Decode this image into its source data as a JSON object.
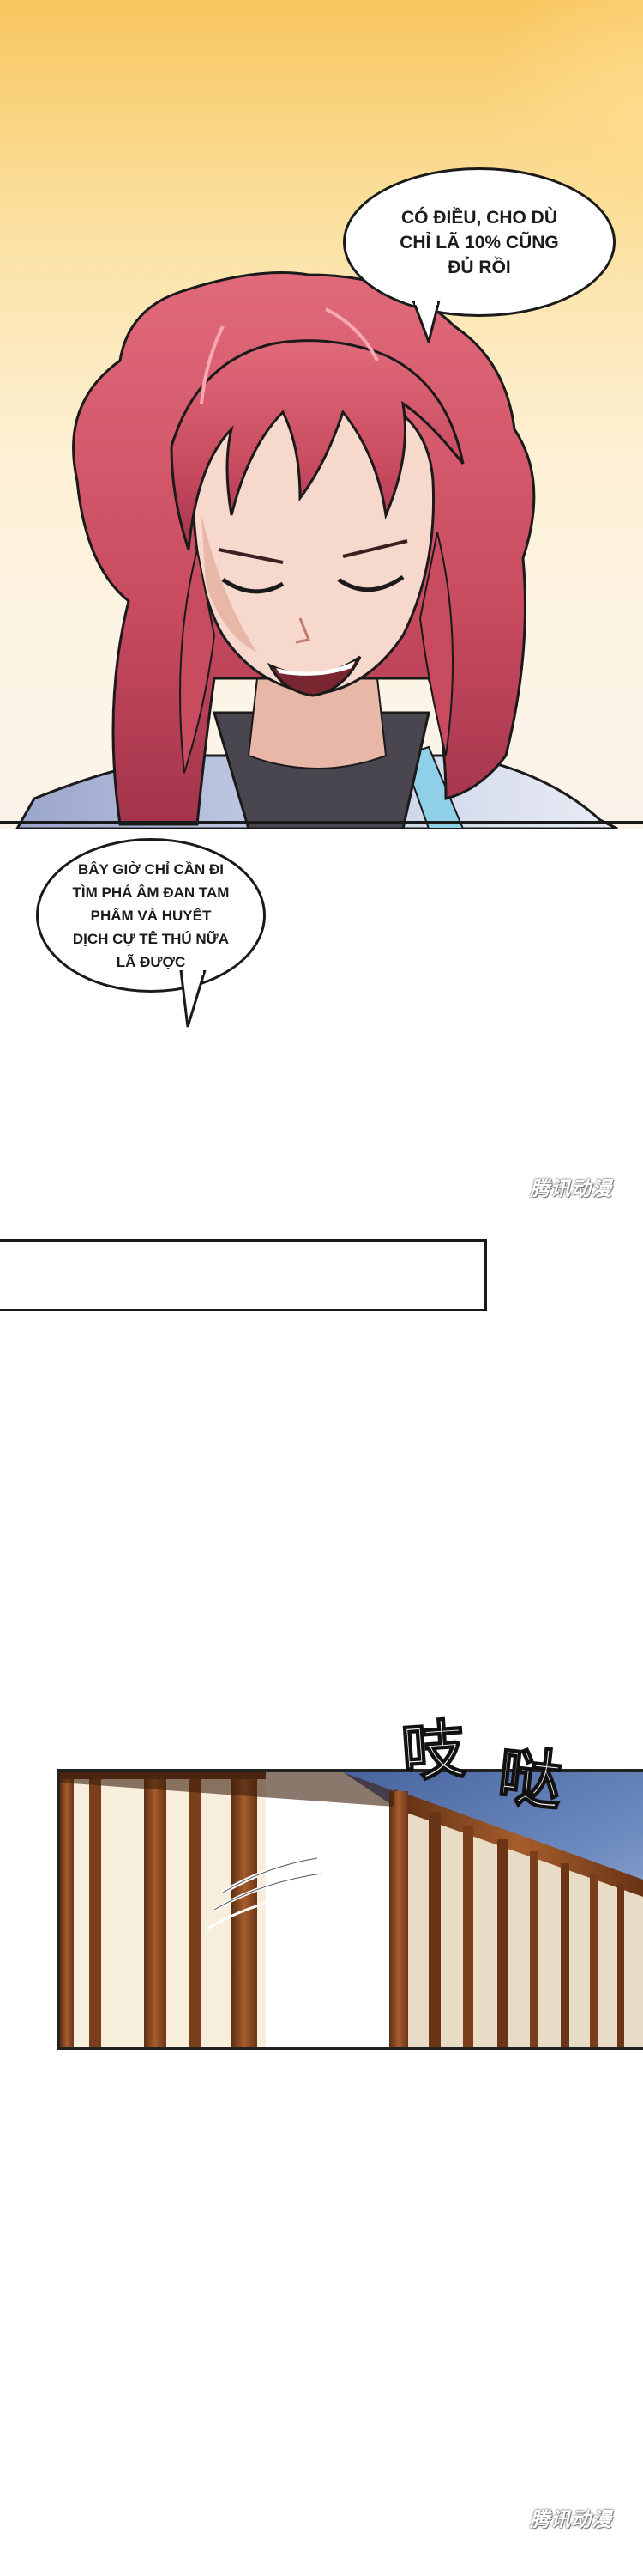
{
  "bubbles": {
    "first": "CÓ ĐIỀU, CHO DÙ CHỈ LÃ 10% CŨNG ĐỦ RỒI",
    "second": "BÂY GIỜ CHỈ CẦN ĐI TÌM PHÁ ÂM ĐAN TAM PHẨM VÀ HUYẾT DỊCH CỰ TÊ THÚ NỮA LÃ ĐƯỢC"
  },
  "sound_effect": {
    "char1": "吱",
    "char2": "哒"
  },
  "watermarks": {
    "mid": "腾讯动漫",
    "bottom": "腾讯动漫"
  },
  "colors": {
    "hair": "#cf4f63",
    "skin": "#f7d8cc",
    "sky": "#4f6fa6",
    "wood": "#8a4b22"
  }
}
